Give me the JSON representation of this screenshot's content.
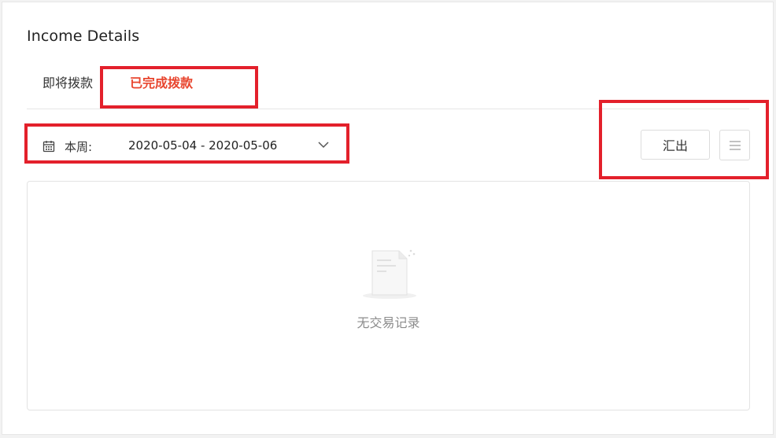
{
  "page": {
    "title": "Income Details"
  },
  "tabs": [
    {
      "label": "即将拨款",
      "active": false
    },
    {
      "label": "已完成拨款",
      "active": true
    }
  ],
  "filter": {
    "date_label": "本周:",
    "date_range": "2020-05-04 - 2020-05-06",
    "icon": "calendar-icon"
  },
  "toolbar": {
    "export_label": "汇出",
    "menu_icon": "menu-icon"
  },
  "empty_state": {
    "message": "无交易记录",
    "icon": "empty-document-icon"
  },
  "colors": {
    "accent": "#e8452e",
    "highlight": "#e3202b"
  }
}
